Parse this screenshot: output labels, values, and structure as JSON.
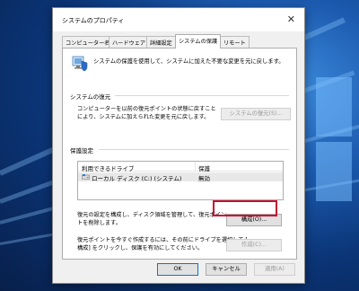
{
  "dialog": {
    "title": "システムのプロパティ",
    "close_glyph": "✕"
  },
  "tabs": [
    {
      "label": "コンピューター名"
    },
    {
      "label": "ハードウェア"
    },
    {
      "label": "詳細設定"
    },
    {
      "label": "システムの保護"
    },
    {
      "label": "リモート"
    }
  ],
  "intro": "システムの保護を使用して、システムに加えた不要な変更を元に戻します。",
  "restore": {
    "section_label": "システムの復元",
    "description_line1": "コンピューターを以前の復元ポイントの状態に戻すこと",
    "description_line2": "により、システムに加えられた変更を元に戻します。",
    "button_label": "システムの復元(S)..."
  },
  "protection": {
    "section_label": "保護設定",
    "columns": [
      "利用できるドライブ",
      "保護"
    ],
    "drives": [
      {
        "name": "ローカル ディスク (C:) (システム)",
        "status": "無効"
      }
    ],
    "configure_desc_line1": "復元の設定を構成し、ディスク領域を管理して、復元ポイン",
    "configure_desc_line2": "トを削除します。",
    "configure_button_label": "構成(O)...",
    "create_desc_line1": "復元ポイントを今すぐ作成するには、その前にドライブを選択して [",
    "create_desc_line2": "構成] をクリックし、保護を有効にしてください。",
    "create_button_label": "作成(C)..."
  },
  "footer": {
    "ok_label": "OK",
    "cancel_label": "キャンセル",
    "apply_label": "適用(A)"
  },
  "colors": {
    "highlight": "#c8102e",
    "accent": "#0078d7"
  }
}
